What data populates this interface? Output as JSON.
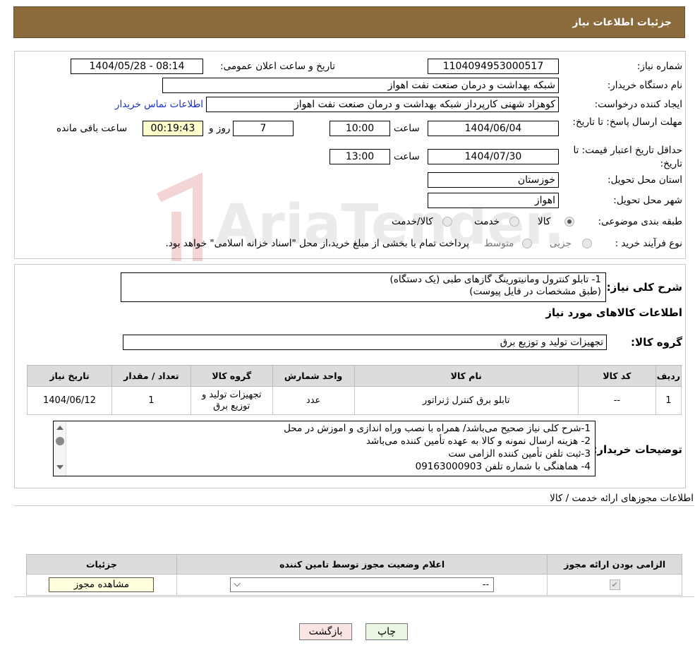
{
  "header": {
    "title": "جزئیات اطلاعات نیاز"
  },
  "watermark": {
    "text": "AriaTender.neT"
  },
  "need": {
    "need_number_label": "شماره نیاز:",
    "need_number": "1104094953000517",
    "announce_label": "تاریخ و ساعت اعلان عمومی:",
    "announce_value": "1404/05/28 - 08:14",
    "buyer_label": "نام دستگاه خریدار:",
    "buyer_value": "شبکه بهداشت و درمان صنعت نفت اهواز",
    "creator_label": "ایجاد کننده درخواست:",
    "creator_value": "کوهزاد شهنی کارپرداز شبکه بهداشت و درمان صنعت نفت اهواز",
    "contact_link": "اطلاعات تماس خریدار",
    "reply_deadline_label": "مهلت ارسال پاسخ: تا تاریخ:",
    "reply_date": "1404/06/04",
    "time_label": "ساعت",
    "reply_time": "10:00",
    "days_value": "7",
    "days_label": "روز و",
    "remaining_value": "00:19:43",
    "remaining_label": "ساعت باقی مانده",
    "price_validity_label": "حداقل تاریخ اعتبار قیمت: تا تاریخ:",
    "price_date": "1404/07/30",
    "price_time": "13:00",
    "province_label": "استان محل تحویل:",
    "province_value": "خوزستان",
    "city_label": "شهر محل تحویل:",
    "city_value": "اهواز",
    "category_label": "طبقه بندی موضوعی:",
    "category_options": [
      "کالا",
      "خدمت",
      "کالا/خدمت"
    ],
    "category_selected": "کالا",
    "process_label": "نوع فرآیند خرید :",
    "process_options": [
      "جزیی",
      "متوسط"
    ],
    "process_note": "پرداخت تمام یا بخشی از مبلغ خرید،از محل \"اسناد خزانه اسلامی\" خواهد بود."
  },
  "summary": {
    "label": "شرح کلی نیاز:",
    "lines": [
      "1- تابلو کنترول ومانیتورینگ گازهای طبی (یک دستگاه)",
      "(طبق مشخصات در فایل پیوست)"
    ],
    "goods_info_title": "اطلاعات کالاهای مورد نیاز",
    "goods_group_label": "گروه کالا:",
    "goods_group_value": "تجهیزات تولید و توزیع برق"
  },
  "goods_table": {
    "headers": [
      "ردیف",
      "کد کالا",
      "نام کالا",
      "واحد شمارش",
      "گروه کالا",
      "تعداد / مقدار",
      "تاریخ نیاز"
    ],
    "rows": [
      [
        "1",
        "--",
        "تابلو برق کنترل ژنراتور",
        "عدد",
        "تجهیزات تولید و توزیع برق",
        "1",
        "1404/06/12"
      ]
    ]
  },
  "buyer_notes": {
    "label": "توضیحات خریدار:",
    "lines": [
      "1-شرح کلی نیاز صحیح می‌باشد/ همراه با نصب وراه اندازی  و اموزش در محل",
      "2- هزینه ارسال نمونه و کالا به عهده تأمین کننده می‌باشد",
      "3-ثبت تلفن تأمین کننده الزامی ست",
      "4- هماهنگی با شماره تلفن 09163000903"
    ]
  },
  "permits": {
    "title": "اطلاعات مجوزهای ارائه خدمت / کالا",
    "headers": [
      "الزامی بودن ارائه مجوز",
      "اعلام وضعیت مجوز توسط تامین کننده",
      "جزئیات"
    ],
    "select_value": "--",
    "view_button": "مشاهده مجوز"
  },
  "footer": {
    "print_button": "چاپ",
    "back_button": "بازگشت"
  }
}
